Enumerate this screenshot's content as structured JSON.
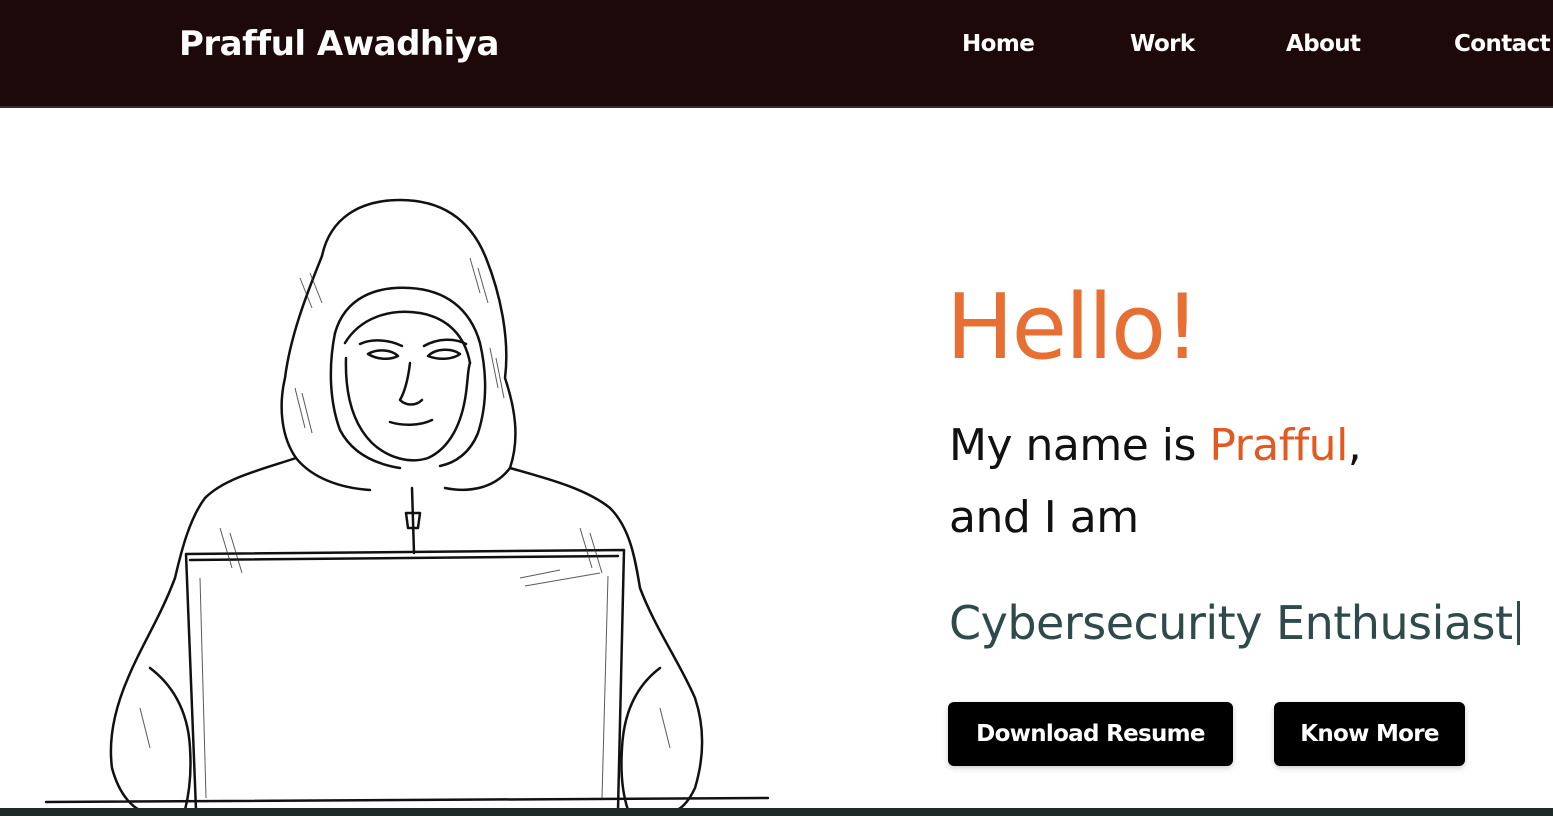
{
  "navbar": {
    "brand": "Prafful Awadhiya",
    "links": [
      "Home",
      "Work",
      "About",
      "Contact"
    ]
  },
  "hero": {
    "greeting": "Hello!",
    "intro_prefix": "My name is ",
    "name": "Prafful",
    "intro_suffix": ",",
    "intro_line2": "and I am",
    "role": "Cybersecurity Enthusiast",
    "buttons": {
      "download_resume": "Download Resume",
      "know_more": "Know More"
    }
  },
  "colors": {
    "navbar_bg": "#1d0909",
    "accent_orange": "#e76f33",
    "role_text": "#2f4a4a",
    "button_bg": "#000000"
  },
  "icons": [
    "hooded-hacker-illustration"
  ]
}
